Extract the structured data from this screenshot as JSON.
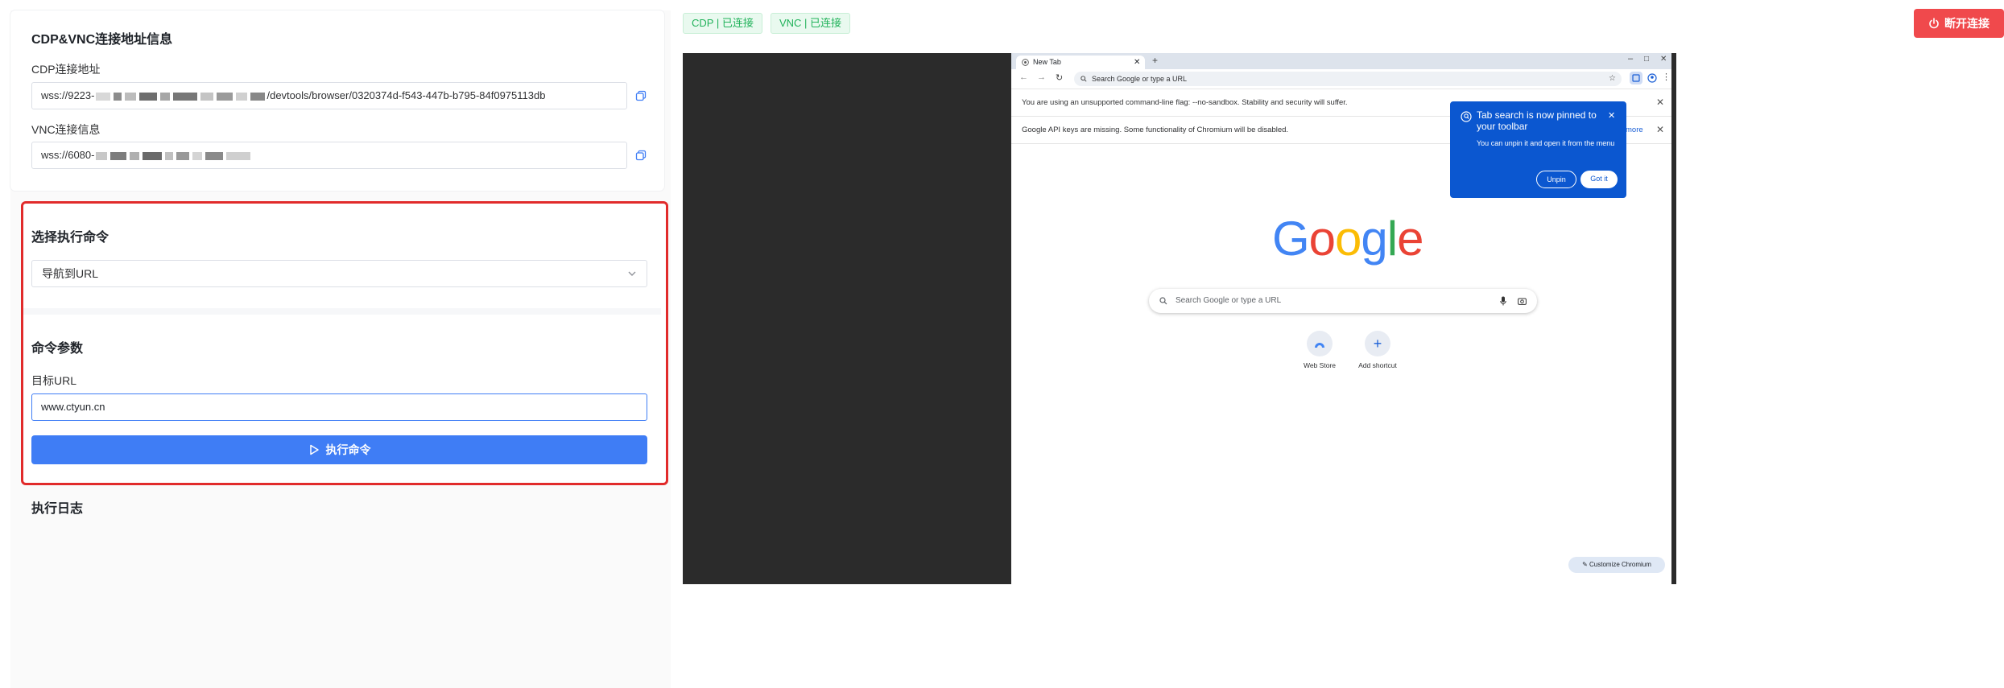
{
  "connection": {
    "title": "CDP&VNC连接地址信息",
    "cdp_label": "CDP连接地址",
    "cdp_prefix": "wss://9223-",
    "cdp_suffix": "/devtools/browser/0320374d-f543-447b-b795-84f0975113db",
    "vnc_label": "VNC连接信息",
    "vnc_prefix": "wss://6080-"
  },
  "command": {
    "select_title": "选择执行命令",
    "selected_command": "导航到URL",
    "params_title": "命令参数",
    "target_url_label": "目标URL",
    "target_url_value": "www.ctyun.cn",
    "execute_label": "执行命令"
  },
  "log": {
    "title": "执行日志"
  },
  "status": {
    "cdp": "CDP | 已连接",
    "vnc": "VNC | 已连接"
  },
  "disconnect_label": "断开连接",
  "browser": {
    "tab_title": "New Tab",
    "omnibox_placeholder": "Search Google or type a URL",
    "infobar_sandbox": "You are using an unsupported command-line flag: --no-sandbox. Stability and security will suffer.",
    "infobar_api": "Google API keys are missing. Some functionality of Chromium will be disabled.",
    "learn_more": "more",
    "popup_title": "Tab search is now pinned to your toolbar",
    "popup_body": "You can unpin it and open it from the menu",
    "popup_unpin": "Unpin",
    "popup_got_it": "Got it",
    "logo_text": "Google",
    "ntp_search_placeholder": "Search Google or type a URL",
    "shortcut_webstore": "Web Store",
    "shortcut_add": "Add shortcut",
    "customize_label": "Customize Chromium"
  },
  "colors": {
    "accent": "#3f7df5",
    "danger": "#f0494c",
    "success": "#21b25a",
    "highlight_border": "#e12b2b"
  },
  "icons": [
    "copy-icon",
    "chevron-down-icon",
    "play-icon",
    "power-icon",
    "search-icon",
    "mic-icon",
    "camera-icon",
    "close-icon"
  ]
}
